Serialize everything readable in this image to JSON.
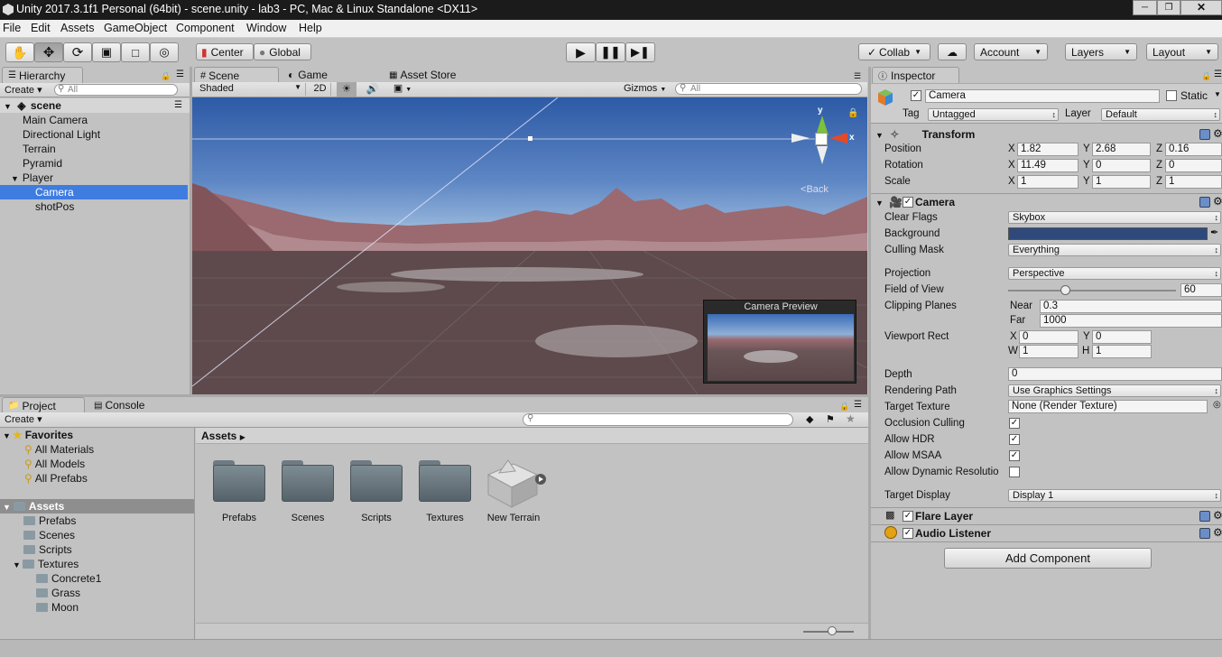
{
  "window": {
    "title": "Unity 2017.3.1f1 Personal (64bit) - scene.unity - lab3 - PC, Mac & Linux Standalone <DX11>"
  },
  "menu": [
    "File",
    "Edit",
    "Assets",
    "GameObject",
    "Component",
    "Window",
    "Help"
  ],
  "toolbar": {
    "center": "Center",
    "global": "Global",
    "collab": "Collab",
    "account": "Account",
    "layers": "Layers",
    "layout": "Layout"
  },
  "hierarchy": {
    "tab": "Hierarchy",
    "create": "Create",
    "search_placeholder": "All",
    "scene": "scene",
    "items": [
      "Main Camera",
      "Directional Light",
      "Terrain",
      "Pyramid",
      "Player",
      "Camera",
      "shotPos"
    ]
  },
  "scene_view": {
    "tabs": [
      "Scene",
      "Game",
      "Asset Store"
    ],
    "shading": "Shaded",
    "mode2d": "2D",
    "gizmos": "Gizmos",
    "search_placeholder": "All",
    "gizmo_back": "Back",
    "gizmo_y": "y",
    "gizmo_x": "x",
    "preview_title": "Camera Preview"
  },
  "project": {
    "tabs": [
      "Project",
      "Console"
    ],
    "create": "Create",
    "favorites": {
      "label": "Favorites",
      "items": [
        "All Materials",
        "All Models",
        "All Prefabs"
      ]
    },
    "assets_root": "Assets",
    "tree": [
      "Prefabs",
      "Scenes",
      "Scripts",
      "Textures",
      "Concrete1",
      "Grass",
      "Moon"
    ],
    "breadcrumb": "Assets",
    "grid": [
      "Prefabs",
      "Scenes",
      "Scripts",
      "Textures",
      "New Terrain"
    ]
  },
  "inspector": {
    "tab": "Inspector",
    "name": "Camera",
    "static": "Static",
    "tag_label": "Tag",
    "tag": "Untagged",
    "layer_label": "Layer",
    "layer": "Default",
    "transform": {
      "title": "Transform",
      "position_label": "Position",
      "position": {
        "x": "1.82",
        "y": "2.68",
        "z": "0.16"
      },
      "rotation_label": "Rotation",
      "rotation": {
        "x": "11.49",
        "y": "0",
        "z": "0"
      },
      "scale_label": "Scale",
      "scale": {
        "x": "1",
        "y": "1",
        "z": "1"
      },
      "axis": {
        "x": "X",
        "y": "Y",
        "z": "Z"
      }
    },
    "camera": {
      "title": "Camera",
      "clear_flags_label": "Clear Flags",
      "clear_flags": "Skybox",
      "background_label": "Background",
      "background_color": "#2f4a7a",
      "culling_label": "Culling Mask",
      "culling": "Everything",
      "projection_label": "Projection",
      "projection": "Perspective",
      "fov_label": "Field of View",
      "fov": "60",
      "fov_fraction": 0.34,
      "clip_label": "Clipping Planes",
      "near_label": "Near",
      "near": "0.3",
      "far_label": "Far",
      "far": "1000",
      "viewport_label": "Viewport Rect",
      "vx": "0",
      "vy": "0",
      "vw": "1",
      "vh": "1",
      "vx_label": "X",
      "vy_label": "Y",
      "vw_label": "W",
      "vh_label": "H",
      "depth_label": "Depth",
      "depth": "0",
      "rendering_label": "Rendering Path",
      "rendering": "Use Graphics Settings",
      "target_tex_label": "Target Texture",
      "target_tex": "None (Render Texture)",
      "occlusion_label": "Occlusion Culling",
      "hdr_label": "Allow HDR",
      "msaa_label": "Allow MSAA",
      "dyn_label": "Allow Dynamic Resolutio",
      "display_label": "Target Display",
      "display": "Display 1"
    },
    "flare": "Flare Layer",
    "audio": "Audio Listener",
    "add_component": "Add Component"
  }
}
